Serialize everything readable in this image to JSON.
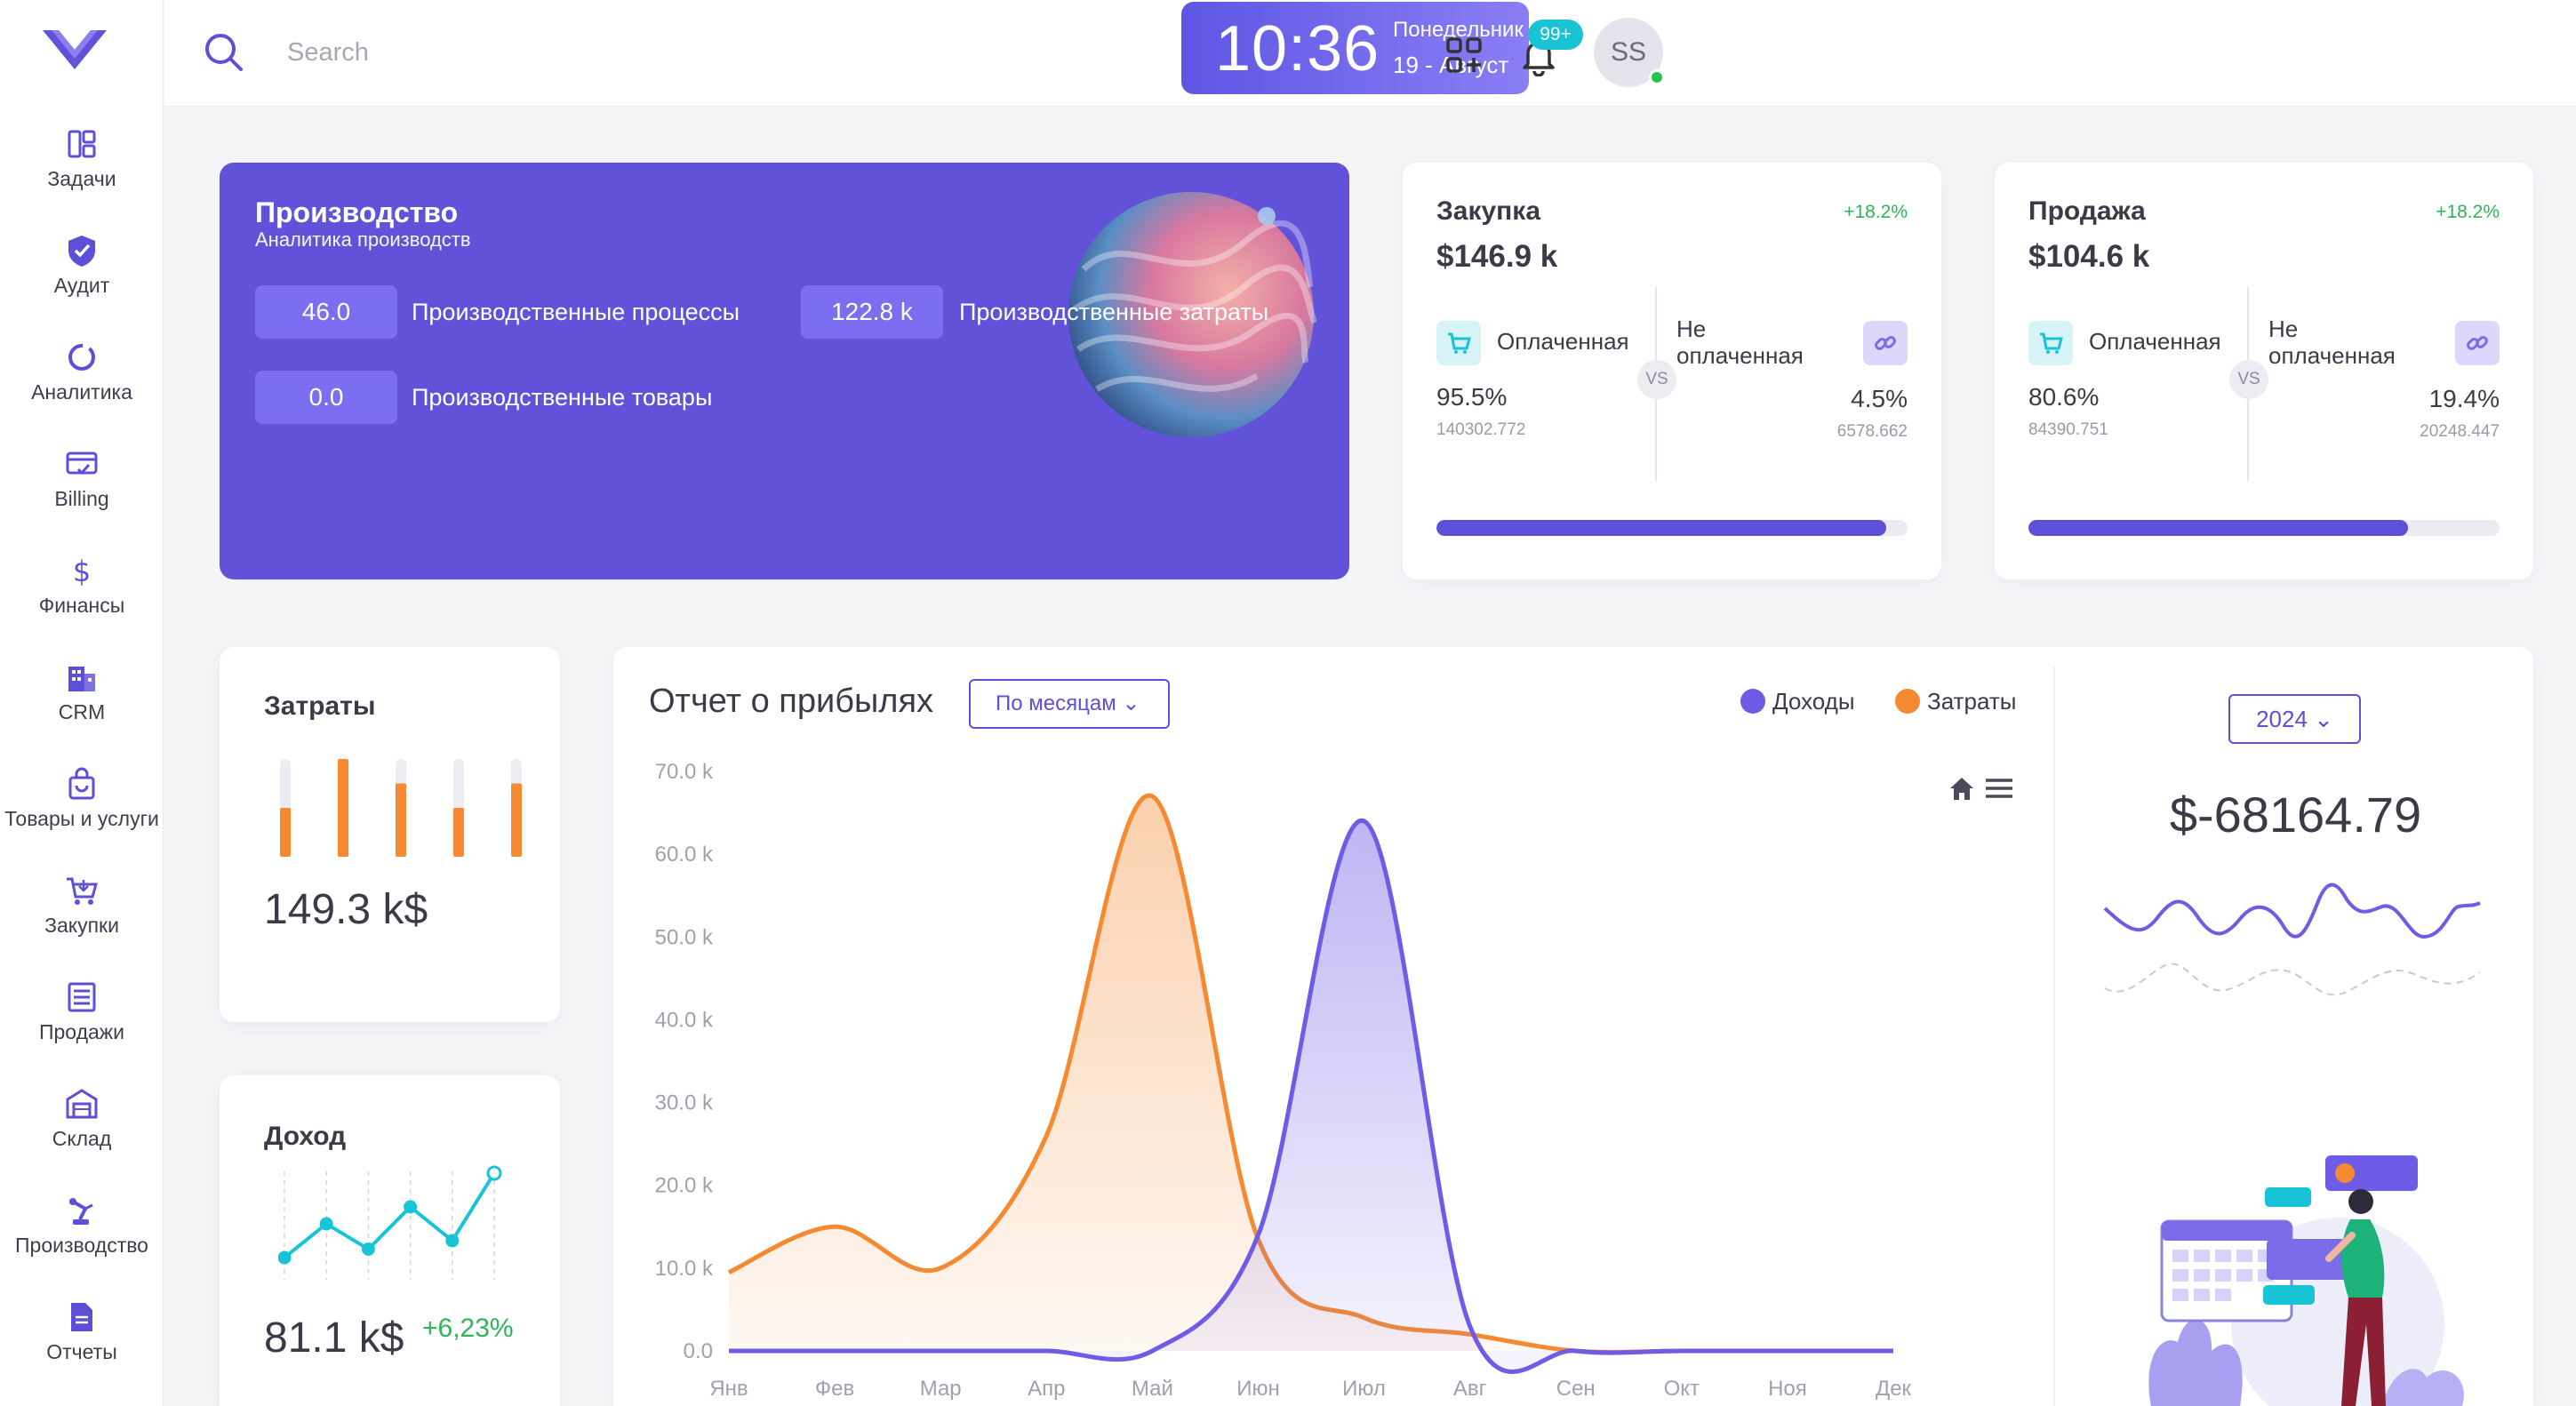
{
  "sidebar": {
    "items": [
      {
        "label": "Задачи",
        "icon": "tasks-icon"
      },
      {
        "label": "Аудит",
        "icon": "shield-icon"
      },
      {
        "label": "Аналитика",
        "icon": "analytics-icon"
      },
      {
        "label": "Billing",
        "icon": "billing-icon"
      },
      {
        "label": "Финансы",
        "icon": "dollar-icon"
      },
      {
        "label": "CRM",
        "icon": "building-icon"
      },
      {
        "label": "Товары и услуги",
        "icon": "bag-icon"
      },
      {
        "label": "Закупки",
        "icon": "cart-icon"
      },
      {
        "label": "Продажи",
        "icon": "list-icon"
      },
      {
        "label": "Склад",
        "icon": "warehouse-icon"
      },
      {
        "label": "Производство",
        "icon": "robot-arm-icon"
      },
      {
        "label": "Отчеты",
        "icon": "document-icon"
      }
    ]
  },
  "header": {
    "search_placeholder": "Search",
    "time": "10:36",
    "day": "Понедельник",
    "date": "19 - Август",
    "notifications": "99+",
    "avatar_initials": "SS"
  },
  "production": {
    "title": "Производство",
    "subtitle": "Аналитика производств",
    "metrics": [
      {
        "value": "46.0",
        "label": "Производственные процессы"
      },
      {
        "value": "122.8 k",
        "label": "Производственные затраты"
      },
      {
        "value": "0.0",
        "label": "Производственные товары"
      }
    ]
  },
  "purchases": {
    "title": "Закупка",
    "change": "+18.2%",
    "value": "$146.9 k",
    "paid_label": "Оплаченная",
    "unpaid_label_1": "Не",
    "unpaid_label_2": "оплаченная",
    "vs": "VS",
    "paid_pct": "95.5%",
    "paid_amount": "140302.772",
    "unpaid_pct": "4.5%",
    "unpaid_amount": "6578.662",
    "progress": 0.955
  },
  "sales": {
    "title": "Продажа",
    "change": "+18.2%",
    "value": "$104.6 k",
    "paid_label": "Оплаченная",
    "unpaid_label_1": "Не",
    "unpaid_label_2": "оплаченная",
    "vs": "VS",
    "paid_pct": "80.6%",
    "paid_amount": "84390.751",
    "unpaid_pct": "19.4%",
    "unpaid_amount": "20248.447",
    "progress": 0.806
  },
  "expenses": {
    "title": "Затраты",
    "value": "149.3 k$",
    "bar_levels": [
      0.5,
      1.0,
      0.75,
      0.5,
      0.75
    ]
  },
  "income": {
    "title": "Доход",
    "value": "81.1 k$",
    "change": "+6,23%",
    "sparkline": [
      2,
      6,
      3,
      8,
      4,
      12
    ]
  },
  "report": {
    "title": "Отчет о прибылях",
    "period": "По месяцам",
    "year": "2024",
    "balance": "$-68164.79"
  },
  "colors": {
    "primary": "#5e4fd8",
    "income_series": "#6e5ce6",
    "expense_series": "#f58a32",
    "positive": "#2fb457",
    "teal": "#18c3d6"
  },
  "chart_data": {
    "type": "area",
    "title": "Отчет о прибылях",
    "categories": [
      "Янв",
      "Фев",
      "Мар",
      "Апр",
      "Май",
      "Июн",
      "Июл",
      "Авг",
      "Сен",
      "Окт",
      "Ноя",
      "Дек"
    ],
    "y_ticks": [
      "0.0",
      "10.0 k",
      "20.0 k",
      "30.0 k",
      "40.0 k",
      "50.0 k",
      "60.0 k",
      "70.0 k"
    ],
    "ylim": [
      0,
      70000
    ],
    "legend_position": "top-right",
    "series": [
      {
        "name": "Доходы",
        "color": "#6e5ce6",
        "values": [
          0,
          0,
          0,
          0,
          0,
          14000,
          64000,
          3000,
          0,
          0,
          0,
          0
        ]
      },
      {
        "name": "Затраты",
        "color": "#f58a32",
        "values": [
          9500,
          15000,
          10000,
          26000,
          67000,
          13500,
          4000,
          2000,
          0,
          0,
          0,
          0
        ]
      }
    ]
  }
}
